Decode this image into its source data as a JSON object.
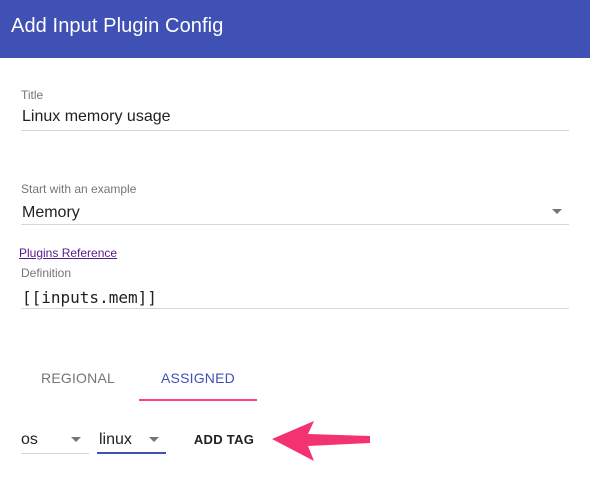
{
  "header": {
    "title": "Add Input Plugin Config"
  },
  "form": {
    "title_field": {
      "label": "Title",
      "value": "Linux memory usage"
    },
    "example_field": {
      "label": "Start with an example",
      "value": "Memory"
    },
    "plugins_reference_link": "Plugins Reference",
    "definition_field": {
      "label": "Definition",
      "value": "[[inputs.mem]]"
    }
  },
  "tabs": [
    {
      "label": "REGIONAL",
      "active": false
    },
    {
      "label": "ASSIGNED",
      "active": true
    }
  ],
  "tag_editor": {
    "key_select": "os",
    "value_select": "linux",
    "add_tag_label": "ADD TAG"
  },
  "colors": {
    "header": "#3f51b5",
    "accent": "#ff4081",
    "active_tab": "#3f51b5",
    "annotation_arrow": "#f2336f"
  },
  "annotation": {
    "icon": "pointer-arrow-icon"
  }
}
